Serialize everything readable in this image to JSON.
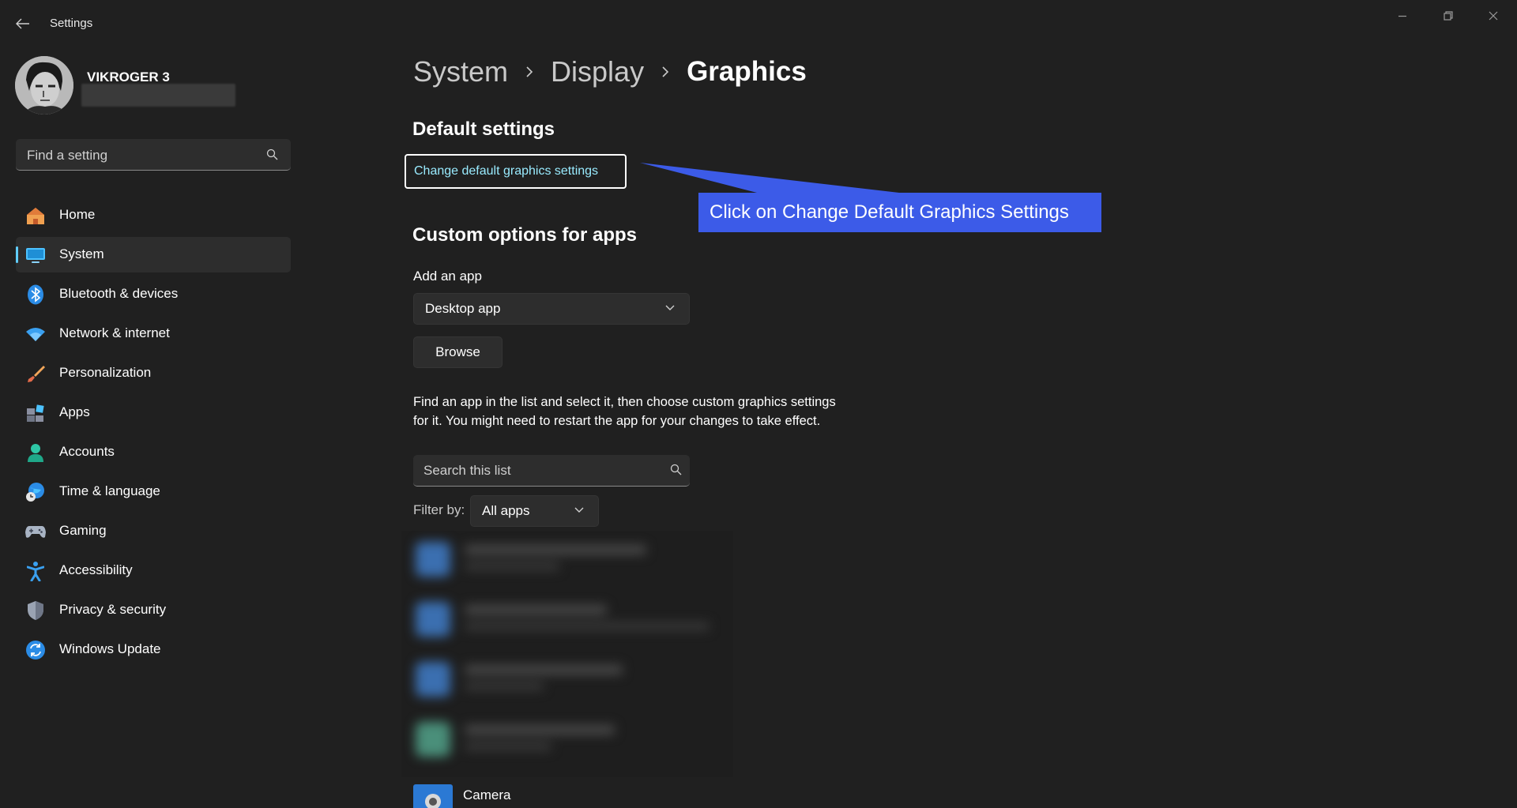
{
  "window": {
    "title": "Settings"
  },
  "profile": {
    "name": "VIKROGER 3"
  },
  "search": {
    "placeholder": "Find a setting"
  },
  "nav": {
    "items": [
      {
        "label": "Home",
        "icon": "home-icon"
      },
      {
        "label": "System",
        "icon": "monitor-icon",
        "active": true
      },
      {
        "label": "Bluetooth & devices",
        "icon": "bluetooth-icon"
      },
      {
        "label": "Network & internet",
        "icon": "wifi-icon"
      },
      {
        "label": "Personalization",
        "icon": "brush-icon"
      },
      {
        "label": "Apps",
        "icon": "apps-icon"
      },
      {
        "label": "Accounts",
        "icon": "person-icon"
      },
      {
        "label": "Time & language",
        "icon": "globe-clock-icon"
      },
      {
        "label": "Gaming",
        "icon": "gamepad-icon"
      },
      {
        "label": "Accessibility",
        "icon": "accessibility-icon"
      },
      {
        "label": "Privacy & security",
        "icon": "shield-icon"
      },
      {
        "label": "Windows Update",
        "icon": "update-icon"
      }
    ]
  },
  "breadcrumb": {
    "items": [
      "System",
      "Display",
      "Graphics"
    ]
  },
  "default_settings": {
    "title": "Default settings",
    "link": "Change default graphics settings"
  },
  "callout": {
    "text": "Click on Change Default Graphics Settings",
    "color": "#3c5be8"
  },
  "custom_options": {
    "title": "Custom options for apps",
    "add_app_label": "Add an app",
    "app_type": "Desktop app",
    "browse_label": "Browse",
    "description": "Find an app in the list and select it, then choose custom graphics settings for it. You might need to restart the app for your changes to take effect.",
    "list_search_placeholder": "Search this list",
    "filter_label": "Filter by:",
    "filter_value": "All apps",
    "visible_app": "Camera"
  },
  "colors": {
    "accent": "#60cdff",
    "link": "#99ebff",
    "background": "#202020"
  }
}
